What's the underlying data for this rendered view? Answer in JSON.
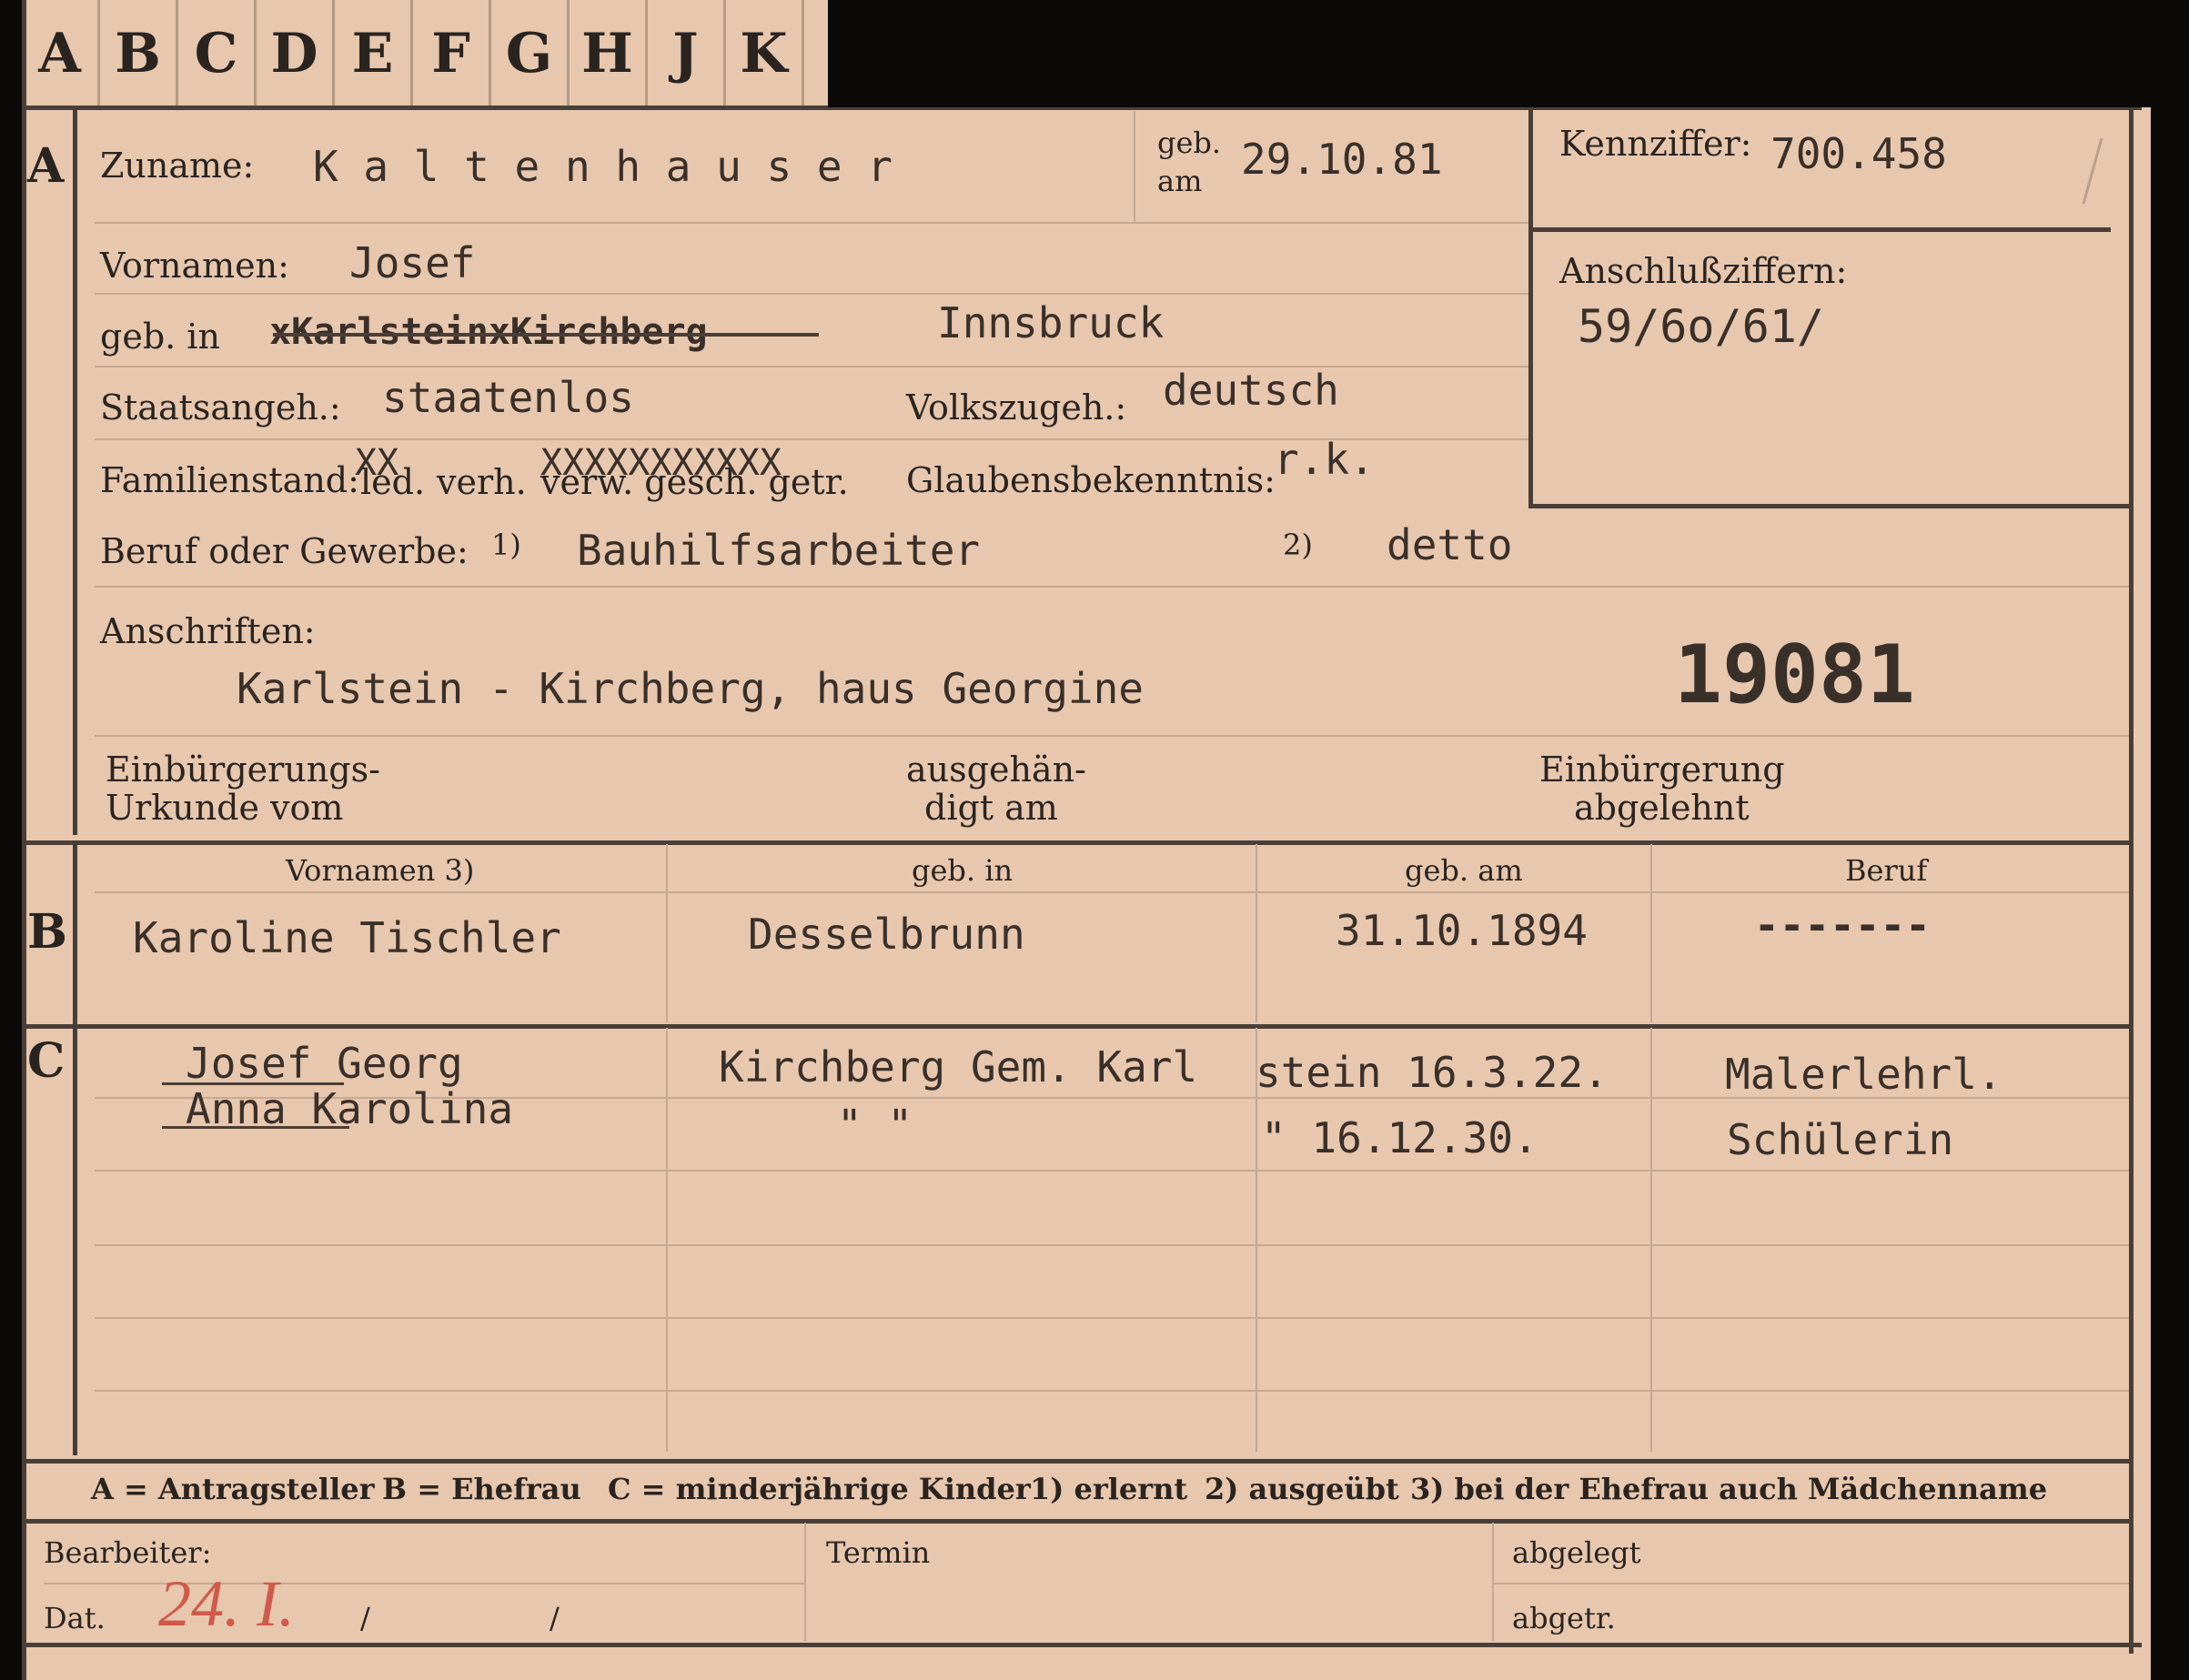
{
  "tabs": [
    "A",
    "B",
    "C",
    "D",
    "E",
    "F",
    "G",
    "H",
    "J",
    "K"
  ],
  "section_a": {
    "marker": "A",
    "zuname_label": "Zuname:",
    "zuname": "K a l t e n h a u s e r",
    "gebam_label_1": "geb.",
    "gebam_label_2": "am",
    "gebam": "29.10.81",
    "kennziffer_label": "Kennziffer:",
    "kennziffer": "700.458",
    "anschluss_label": "Anschlußziffern:",
    "anschluss": "59/6o/61/",
    "vornamen_label": "Vornamen:",
    "vornamen": "Josef",
    "gebin_label": "geb. in",
    "gebin_struck": "xKarlsteinxKirchberg",
    "gebin": "Innsbruck",
    "staats_label": "Staatsangeh.:",
    "staats": "staatenlos",
    "volks_label": "Volkszugeh.:",
    "volks": "deutsch",
    "familien_label": "Familienstand:",
    "familien_options": [
      "led.",
      "verh.",
      "verw. gesch. getr."
    ],
    "familien_x1": "XX",
    "familien_x2": "XXXXXXXXXXX",
    "glauben_label": "Glaubensbekenntnis:",
    "glauben": "r.k.",
    "beruf_label": "Beruf oder Gewerbe:",
    "beruf_note1": "1)",
    "beruf": "Bauhilfsarbeiter",
    "beruf_note2": "2)",
    "beruf2": "detto",
    "anschriften_label": "Anschriften:",
    "anschrift": "Karlstein - Kirchberg, haus Georgine",
    "stamp_number": "19081",
    "einb_label_1": "Einbürgerungs-",
    "einb_label_2": "Urkunde vom",
    "ausg_label_1": "ausgehän-",
    "ausg_label_2": "digt am",
    "abgel_label_1": "Einbürgerung",
    "abgel_label_2": "abgelehnt"
  },
  "section_b": {
    "marker": "B",
    "headers": [
      "Vornamen 3)",
      "geb. in",
      "geb. am",
      "Beruf"
    ],
    "row": [
      "Karoline Tischler",
      "Desselbrunn",
      "31.10.1894",
      "-------"
    ]
  },
  "section_c": {
    "marker": "C",
    "rows": [
      {
        "name": "Josef  Georg",
        "place": "Kirchberg Gem. Karl",
        "date": "stein 16.3.22.",
        "beruf": "Malerlehrl."
      },
      {
        "name": "Anna Karolina",
        "place": "\"       \"",
        "date": "\"       16.12.30.",
        "beruf": "Schülerin"
      }
    ]
  },
  "legend": {
    "items": [
      "A = Antragsteller",
      "B = Ehefrau",
      "C = minderjährige Kinder",
      "1) erlernt",
      "2) ausgeübt",
      "3) bei der Ehefrau auch Mädchenname"
    ]
  },
  "footer": {
    "bearbeiter_label": "Bearbeiter:",
    "dat_label": "Dat.",
    "dat_value": "24. I.",
    "dat_slash1": "/",
    "dat_slash2": "/",
    "termin_label": "Termin",
    "abgelegt_label": "abgelegt",
    "abgetr_label": "abgetr."
  },
  "colors": {
    "card": "#e7c7ad",
    "ink": "#2a2420",
    "typewriter": "#3a302a",
    "pencil_red": "#d05a4a",
    "background": "#0c0a08"
  }
}
